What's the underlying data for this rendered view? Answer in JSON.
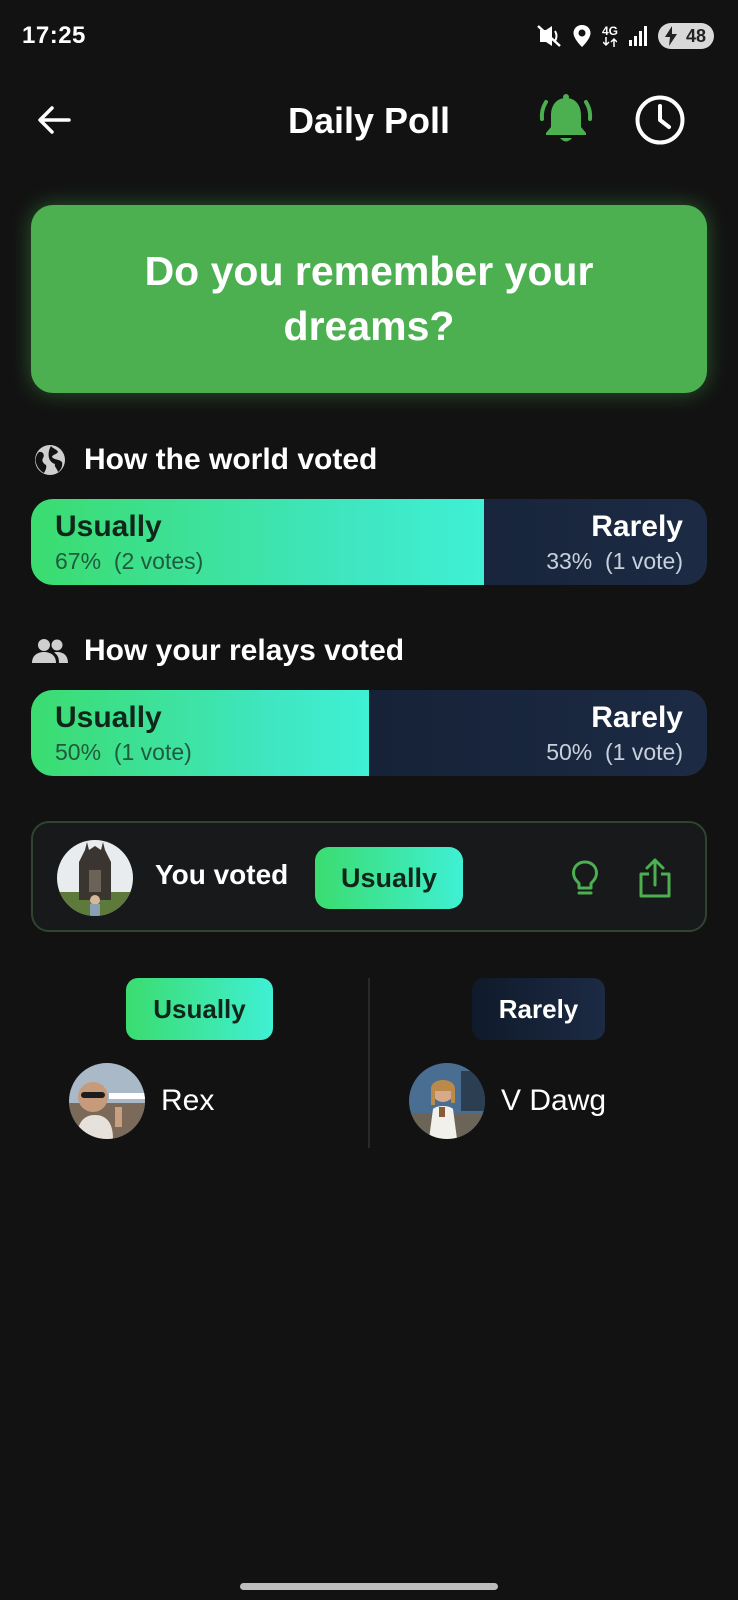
{
  "status_bar": {
    "time": "17:25",
    "network": "4G",
    "battery": "48",
    "icons": [
      "mute-vibrate-icon",
      "location-icon",
      "network-4g-icon",
      "signal-icon",
      "battery-charging-icon"
    ]
  },
  "header": {
    "title": "Daily Poll",
    "back_icon": "arrow-left-icon",
    "bell_icon": "bell-icon",
    "history_icon": "clock-icon",
    "accent": "#4caf50"
  },
  "question": {
    "text": "Do you remember your dreams?",
    "background": "#4caf50"
  },
  "world": {
    "heading": "How the world voted",
    "icon": "globe-icon",
    "option_a": {
      "label": "Usually",
      "percent": "67%",
      "votes": "(2 votes)",
      "share": 0.67
    },
    "option_b": {
      "label": "Rarely",
      "percent": "33%",
      "votes": "(1 vote)"
    }
  },
  "relays": {
    "heading": "How your relays voted",
    "icon": "people-icon",
    "option_a": {
      "label": "Usually",
      "percent": "50%",
      "votes": "(1 vote)",
      "share": 0.5
    },
    "option_b": {
      "label": "Rarely",
      "percent": "50%",
      "votes": "(1 vote)"
    }
  },
  "your_vote": {
    "label": "You voted",
    "choice": "Usually",
    "hint_icon": "lightbulb-icon",
    "share_icon": "share-icon"
  },
  "columns": {
    "left": {
      "label": "Usually",
      "voters": [
        {
          "name": "Rex"
        }
      ]
    },
    "right": {
      "label": "Rarely",
      "voters": [
        {
          "name": "V Dawg"
        }
      ]
    }
  },
  "colors": {
    "background": "#121212",
    "green": "#4caf50",
    "gradient_start": "#3bdc6f",
    "gradient_end": "#3ff0d4",
    "navy": "#1c2a44"
  }
}
